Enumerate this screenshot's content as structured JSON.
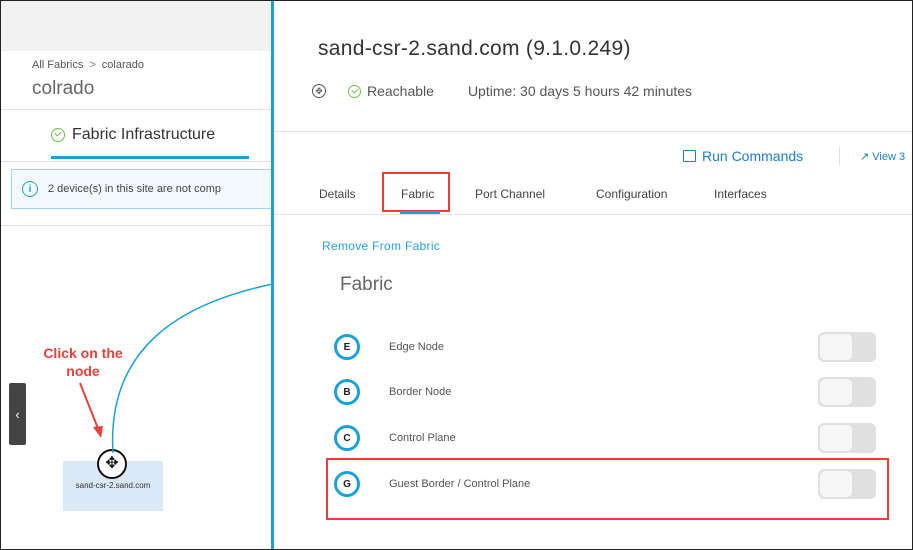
{
  "left_panel": {
    "breadcrumb": {
      "root": "All Fabrics",
      "separator": ">",
      "current": "colarado"
    },
    "site_name": "colrado",
    "tab_label": "Fabric Infrastructure",
    "alert_text": "2 device(s) in this site are not comp",
    "annotation_line1": "Click on the",
    "annotation_line2": "node",
    "node_label": "sand-csr-2.sand.com",
    "collapse_glyph": "‹"
  },
  "device": {
    "title": "sand-csr-2.sand.com (9.1.0.249)",
    "status": "Reachable",
    "uptime": "Uptime: 30 days 5 hours 42 minutes"
  },
  "actions": {
    "run_commands": "Run Commands",
    "view": "View 3"
  },
  "tabs": [
    {
      "label": "Details"
    },
    {
      "label": "Fabric"
    },
    {
      "label": "Port Channel"
    },
    {
      "label": "Configuration"
    },
    {
      "label": "Interfaces"
    }
  ],
  "fabric": {
    "remove_link": "Remove From Fabric",
    "section_title": "Fabric",
    "roles": [
      {
        "badge": "E",
        "label": "Edge Node",
        "enabled": false
      },
      {
        "badge": "B",
        "label": "Border Node",
        "enabled": false
      },
      {
        "badge": "C",
        "label": "Control Plane",
        "enabled": false
      },
      {
        "badge": "G",
        "label": "Guest Border / Control Plane",
        "enabled": false
      }
    ]
  },
  "colors": {
    "accent": "#1ba0d7",
    "highlight": "#e8403a",
    "reachable": "#6cc04a",
    "link": "#1b7fc2"
  }
}
